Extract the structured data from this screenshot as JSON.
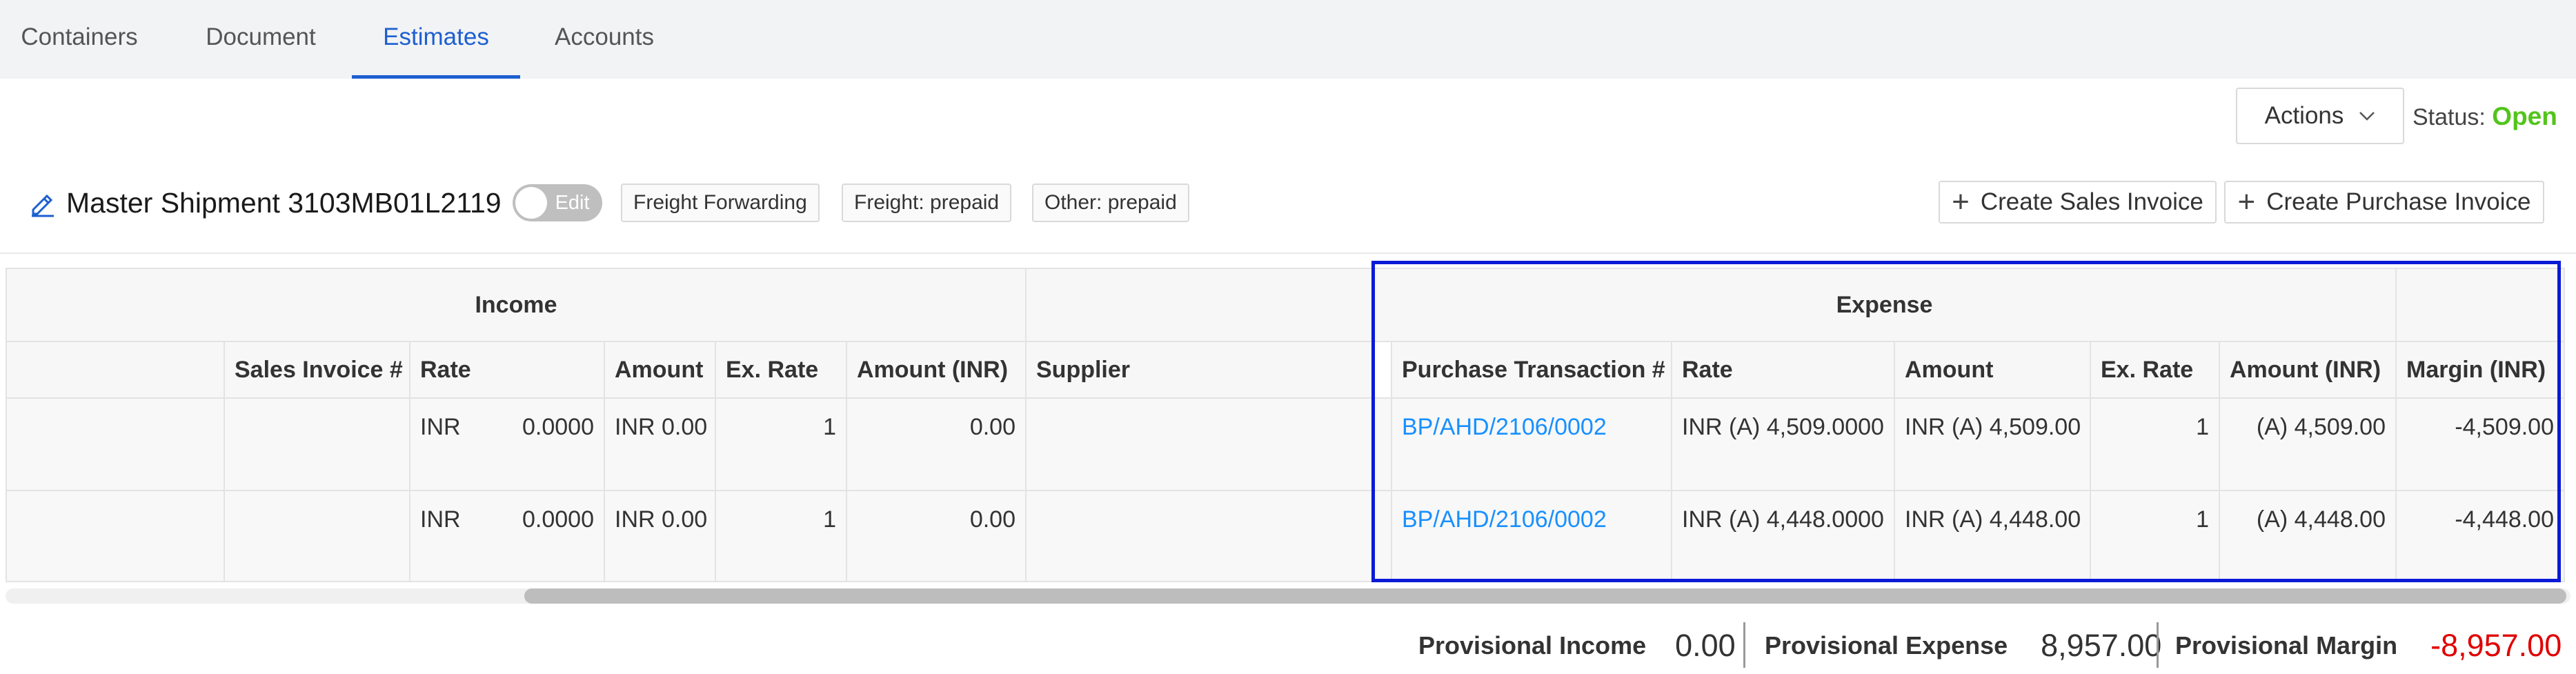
{
  "tabs": [
    {
      "label": "Containers",
      "active": false
    },
    {
      "label": "Document",
      "active": false
    },
    {
      "label": "Estimates",
      "active": true
    },
    {
      "label": "Accounts",
      "active": false
    }
  ],
  "header": {
    "actions_label": "Actions",
    "status_prefix": "Status:",
    "status_value": "Open",
    "status_color": "#52c41a",
    "title": "Master Shipment 3103MB01L2119",
    "edit_toggle_label": "Edit",
    "tags": [
      "Freight Forwarding",
      "Freight: prepaid",
      "Other: prepaid"
    ],
    "create_sales_invoice": "Create Sales Invoice",
    "create_purchase_invoice": "Create Purchase Invoice"
  },
  "table": {
    "groups": {
      "income": "Income",
      "expense": "Expense"
    },
    "columns": {
      "sales_invoice": "Sales Invoice #",
      "income_rate": "Rate",
      "income_amount": "Amount",
      "income_ex_rate": "Ex. Rate",
      "income_amount_inr": "Amount (INR)",
      "supplier": "Supplier",
      "purchase_txn": "Purchase Transaction #",
      "expense_rate": "Rate",
      "expense_amount": "Amount",
      "expense_ex_rate": "Ex. Rate",
      "expense_amount_inr": "Amount (INR)",
      "margin_inr": "Margin (INR)"
    },
    "rows": [
      {
        "sales_invoice": "",
        "income_rate_cur": "INR",
        "income_rate_val": "0.0000",
        "income_amount": "INR 0.00",
        "income_ex_rate": "1",
        "income_amount_inr": "0.00",
        "supplier": "",
        "purchase_txn": "BP/AHD/2106/0002",
        "expense_rate": "INR (A) 4,509.0000",
        "expense_amount": "INR (A) 4,509.00",
        "expense_ex_rate": "1",
        "expense_amount_inr": "(A) 4,509.00",
        "margin_inr": "-4,509.00"
      },
      {
        "sales_invoice": "",
        "income_rate_cur": "INR",
        "income_rate_val": "0.0000",
        "income_amount": "INR 0.00",
        "income_ex_rate": "1",
        "income_amount_inr": "0.00",
        "supplier": "",
        "purchase_txn": "BP/AHD/2106/0002",
        "expense_rate": "INR (A) 4,448.0000",
        "expense_amount": "INR (A) 4,448.00",
        "expense_ex_rate": "1",
        "expense_amount_inr": "(A) 4,448.00",
        "margin_inr": "-4,448.00"
      }
    ]
  },
  "footer": {
    "provisional_income_label": "Provisional Income",
    "provisional_income_value": "0.00",
    "provisional_expense_label": "Provisional Expense",
    "provisional_expense_value": "8,957.00",
    "provisional_margin_label": "Provisional Margin",
    "provisional_margin_value": "-8,957.00",
    "margin_color": "#e00000"
  },
  "colors": {
    "accent": "#1d5fd0",
    "link": "#1890ff",
    "highlight_border": "#0a1ad6"
  }
}
